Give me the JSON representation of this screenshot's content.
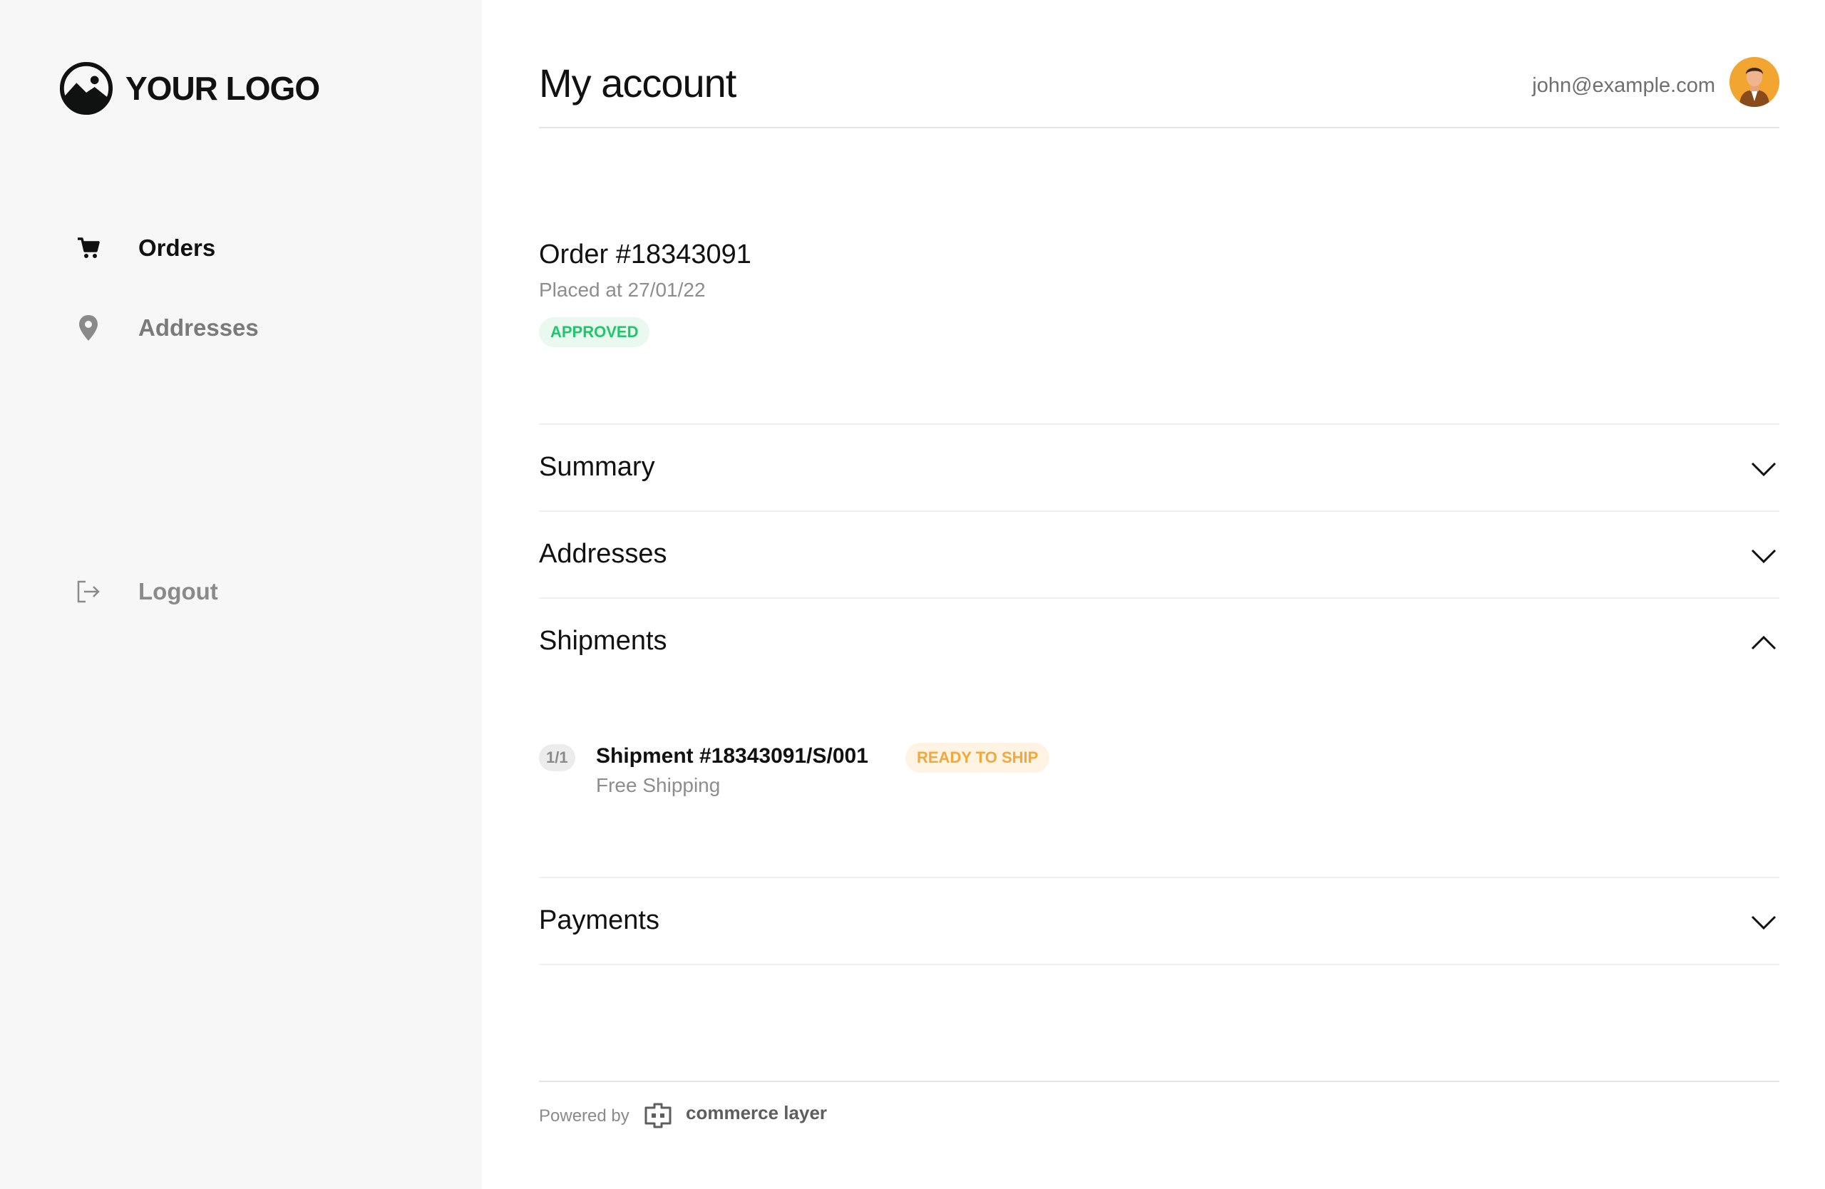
{
  "brand": {
    "logo_text": "YOUR LOGO"
  },
  "sidebar": {
    "items": [
      {
        "label": "Orders",
        "icon": "cart-icon",
        "active": true
      },
      {
        "label": "Addresses",
        "icon": "location-pin-icon",
        "active": false
      }
    ],
    "logout": {
      "label": "Logout",
      "icon": "logout-icon"
    }
  },
  "header": {
    "title": "My account",
    "user_email": "john@example.com",
    "avatar": "avatar"
  },
  "order": {
    "number": "Order #18343091",
    "placed": "Placed at 27/01/22",
    "status": "APPROVED"
  },
  "sections": {
    "summary": {
      "title": "Summary",
      "expanded": false
    },
    "addresses": {
      "title": "Addresses",
      "expanded": false
    },
    "shipments": {
      "title": "Shipments",
      "expanded": true
    },
    "payments": {
      "title": "Payments",
      "expanded": false
    }
  },
  "shipment": {
    "count": "1/1",
    "title": "Shipment #18343091/S/001",
    "status": "READY TO SHIP",
    "method": "Free Shipping"
  },
  "footer": {
    "powered_by": "Powered by",
    "brand": "commerce layer"
  },
  "colors": {
    "sidebar_bg": "#f7f7f7",
    "approved": "#1fc76a",
    "ready_to_ship": "#f4a83a",
    "avatar_bg": "#f3a531"
  }
}
